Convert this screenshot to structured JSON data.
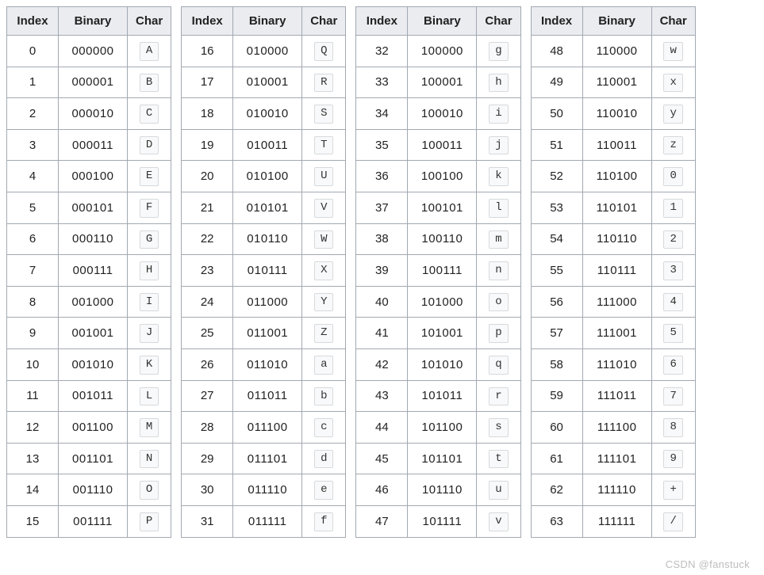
{
  "headers": {
    "index": "Index",
    "binary": "Binary",
    "char": "Char"
  },
  "watermark": "CSDN @fanstuck",
  "tables": [
    {
      "rows": [
        {
          "index": "0",
          "binary": "000000",
          "char": "A"
        },
        {
          "index": "1",
          "binary": "000001",
          "char": "B"
        },
        {
          "index": "2",
          "binary": "000010",
          "char": "C"
        },
        {
          "index": "3",
          "binary": "000011",
          "char": "D"
        },
        {
          "index": "4",
          "binary": "000100",
          "char": "E"
        },
        {
          "index": "5",
          "binary": "000101",
          "char": "F"
        },
        {
          "index": "6",
          "binary": "000110",
          "char": "G"
        },
        {
          "index": "7",
          "binary": "000111",
          "char": "H"
        },
        {
          "index": "8",
          "binary": "001000",
          "char": "I"
        },
        {
          "index": "9",
          "binary": "001001",
          "char": "J"
        },
        {
          "index": "10",
          "binary": "001010",
          "char": "K"
        },
        {
          "index": "11",
          "binary": "001011",
          "char": "L"
        },
        {
          "index": "12",
          "binary": "001100",
          "char": "M"
        },
        {
          "index": "13",
          "binary": "001101",
          "char": "N"
        },
        {
          "index": "14",
          "binary": "001110",
          "char": "O"
        },
        {
          "index": "15",
          "binary": "001111",
          "char": "P"
        }
      ]
    },
    {
      "rows": [
        {
          "index": "16",
          "binary": "010000",
          "char": "Q"
        },
        {
          "index": "17",
          "binary": "010001",
          "char": "R"
        },
        {
          "index": "18",
          "binary": "010010",
          "char": "S"
        },
        {
          "index": "19",
          "binary": "010011",
          "char": "T"
        },
        {
          "index": "20",
          "binary": "010100",
          "char": "U"
        },
        {
          "index": "21",
          "binary": "010101",
          "char": "V"
        },
        {
          "index": "22",
          "binary": "010110",
          "char": "W"
        },
        {
          "index": "23",
          "binary": "010111",
          "char": "X"
        },
        {
          "index": "24",
          "binary": "011000",
          "char": "Y"
        },
        {
          "index": "25",
          "binary": "011001",
          "char": "Z"
        },
        {
          "index": "26",
          "binary": "011010",
          "char": "a"
        },
        {
          "index": "27",
          "binary": "011011",
          "char": "b"
        },
        {
          "index": "28",
          "binary": "011100",
          "char": "c"
        },
        {
          "index": "29",
          "binary": "011101",
          "char": "d"
        },
        {
          "index": "30",
          "binary": "011110",
          "char": "e"
        },
        {
          "index": "31",
          "binary": "011111",
          "char": "f"
        }
      ]
    },
    {
      "rows": [
        {
          "index": "32",
          "binary": "100000",
          "char": "g"
        },
        {
          "index": "33",
          "binary": "100001",
          "char": "h"
        },
        {
          "index": "34",
          "binary": "100010",
          "char": "i"
        },
        {
          "index": "35",
          "binary": "100011",
          "char": "j"
        },
        {
          "index": "36",
          "binary": "100100",
          "char": "k"
        },
        {
          "index": "37",
          "binary": "100101",
          "char": "l"
        },
        {
          "index": "38",
          "binary": "100110",
          "char": "m"
        },
        {
          "index": "39",
          "binary": "100111",
          "char": "n"
        },
        {
          "index": "40",
          "binary": "101000",
          "char": "o"
        },
        {
          "index": "41",
          "binary": "101001",
          "char": "p"
        },
        {
          "index": "42",
          "binary": "101010",
          "char": "q"
        },
        {
          "index": "43",
          "binary": "101011",
          "char": "r"
        },
        {
          "index": "44",
          "binary": "101100",
          "char": "s"
        },
        {
          "index": "45",
          "binary": "101101",
          "char": "t"
        },
        {
          "index": "46",
          "binary": "101110",
          "char": "u"
        },
        {
          "index": "47",
          "binary": "101111",
          "char": "v"
        }
      ]
    },
    {
      "rows": [
        {
          "index": "48",
          "binary": "110000",
          "char": "w"
        },
        {
          "index": "49",
          "binary": "110001",
          "char": "x"
        },
        {
          "index": "50",
          "binary": "110010",
          "char": "y"
        },
        {
          "index": "51",
          "binary": "110011",
          "char": "z"
        },
        {
          "index": "52",
          "binary": "110100",
          "char": "0"
        },
        {
          "index": "53",
          "binary": "110101",
          "char": "1"
        },
        {
          "index": "54",
          "binary": "110110",
          "char": "2"
        },
        {
          "index": "55",
          "binary": "110111",
          "char": "3"
        },
        {
          "index": "56",
          "binary": "111000",
          "char": "4"
        },
        {
          "index": "57",
          "binary": "111001",
          "char": "5"
        },
        {
          "index": "58",
          "binary": "111010",
          "char": "6"
        },
        {
          "index": "59",
          "binary": "111011",
          "char": "7"
        },
        {
          "index": "60",
          "binary": "111100",
          "char": "8"
        },
        {
          "index": "61",
          "binary": "111101",
          "char": "9"
        },
        {
          "index": "62",
          "binary": "111110",
          "char": "+"
        },
        {
          "index": "63",
          "binary": "111111",
          "char": "/"
        }
      ]
    }
  ]
}
